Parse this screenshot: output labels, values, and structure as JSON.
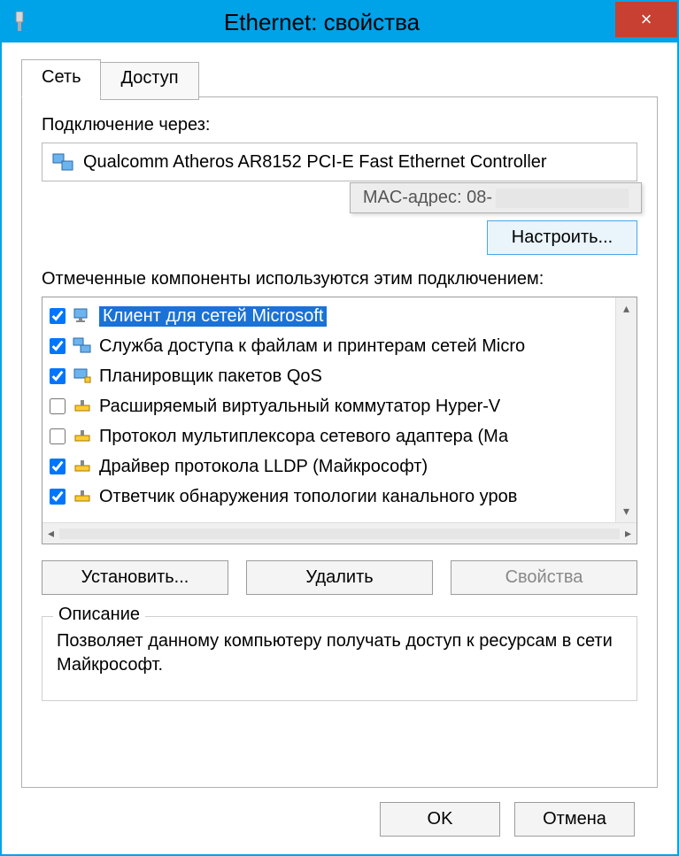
{
  "window": {
    "title": "Ethernet: свойства",
    "close_label": "×"
  },
  "tabs": {
    "network": "Сеть",
    "access": "Доступ"
  },
  "connection": {
    "label": "Подключение через:",
    "adapter": "Qualcomm Atheros AR8152 PCI-E Fast Ethernet Controller",
    "tooltip_label": "MAC-адрес: 08-",
    "configure_btn": "Настроить..."
  },
  "components": {
    "label": "Отмеченные компоненты используются этим подключением:",
    "items": [
      {
        "checked": true,
        "selected": true,
        "icon": "monitor-net",
        "label": "Клиент для сетей Microsoft"
      },
      {
        "checked": true,
        "selected": false,
        "icon": "monitor-share",
        "label": "Служба доступа к файлам и принтерам сетей Micro"
      },
      {
        "checked": true,
        "selected": false,
        "icon": "monitor-plug",
        "label": "Планировщик пакетов QoS"
      },
      {
        "checked": false,
        "selected": false,
        "icon": "protocol",
        "label": "Расширяемый виртуальный коммутатор Hyper-V"
      },
      {
        "checked": false,
        "selected": false,
        "icon": "protocol",
        "label": "Протокол мультиплексора сетевого адаптера (Ма"
      },
      {
        "checked": true,
        "selected": false,
        "icon": "protocol",
        "label": "Драйвер протокола LLDP (Майкрософт)"
      },
      {
        "checked": true,
        "selected": false,
        "icon": "protocol",
        "label": "Ответчик обнаружения топологии канального уров"
      }
    ]
  },
  "buttons": {
    "install": "Установить...",
    "remove": "Удалить",
    "properties": "Свойства"
  },
  "description": {
    "legend": "Описание",
    "text": "Позволяет данному компьютеру получать доступ к ресурсам в сети Майкрософт."
  },
  "footer": {
    "ok": "OK",
    "cancel": "Отмена"
  }
}
